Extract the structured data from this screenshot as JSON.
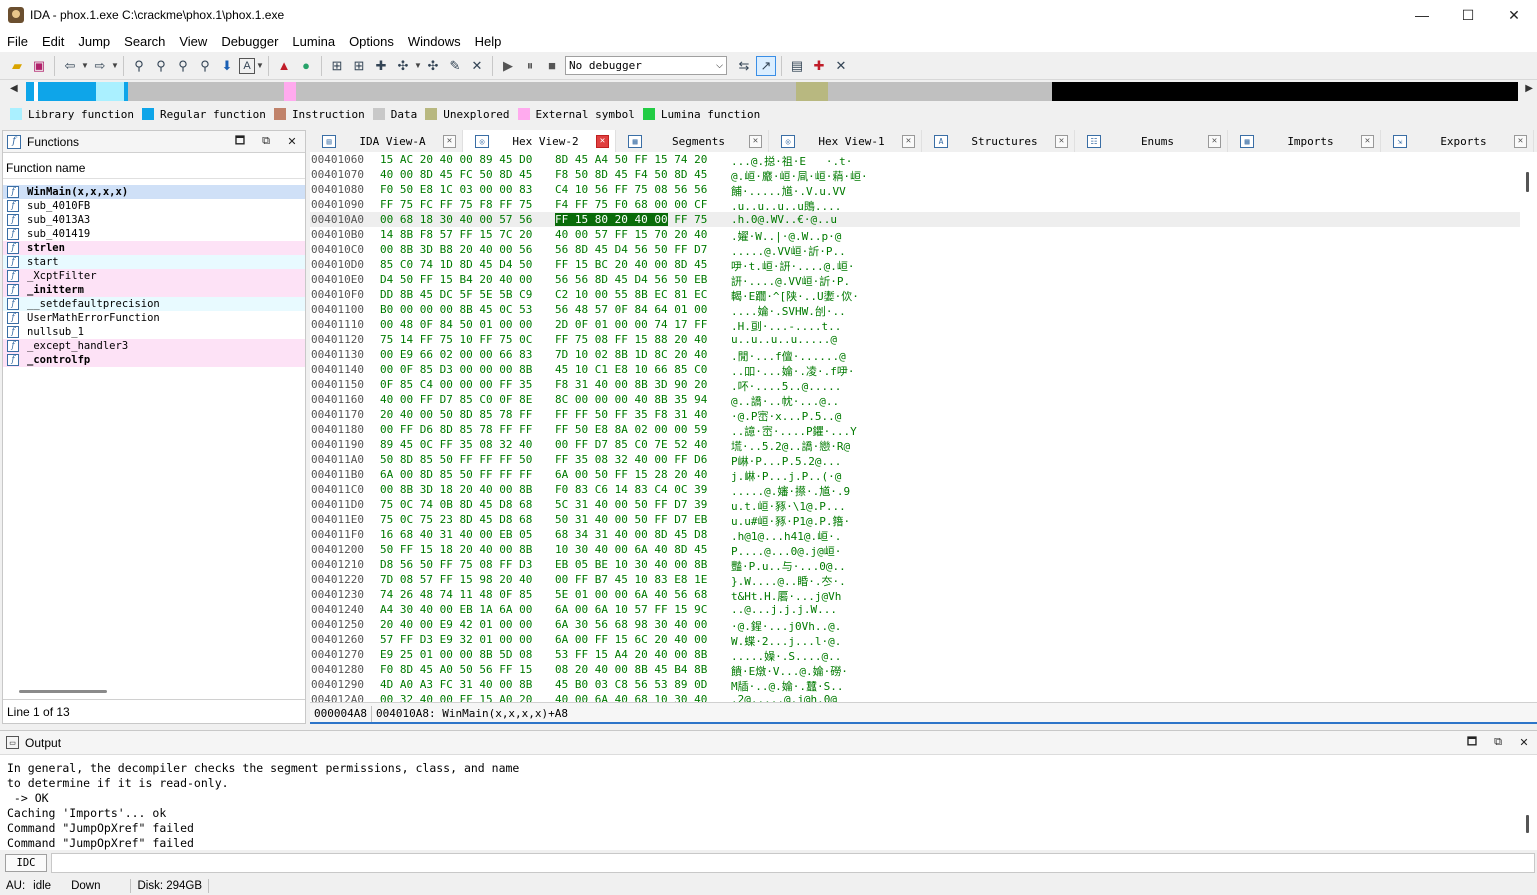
{
  "window": {
    "title": "IDA - phox.1.exe C:\\crackme\\phox.1\\phox.1.exe",
    "controls": [
      "—",
      "☐",
      "✕"
    ]
  },
  "menu": [
    "File",
    "Edit",
    "Jump",
    "Search",
    "View",
    "Debugger",
    "Lumina",
    "Options",
    "Windows",
    "Help"
  ],
  "toolbar": {
    "debugger_select": "No debugger"
  },
  "legend": [
    {
      "label": "Library function",
      "color": "#aaf0ff"
    },
    {
      "label": "Regular function",
      "color": "#0ea5e9"
    },
    {
      "label": "Instruction",
      "color": "#c0826a"
    },
    {
      "label": "Data",
      "color": "#c8c8c8"
    },
    {
      "label": "Unexplored",
      "color": "#b8b880"
    },
    {
      "label": "External symbol",
      "color": "#ffaaee"
    },
    {
      "label": "Lumina function",
      "color": "#22cc44"
    }
  ],
  "functions": {
    "title": "Functions",
    "column": "Function name",
    "items": [
      {
        "name": "WinMain(x,x,x,x)",
        "kind": "sel bold"
      },
      {
        "name": "sub_4010FB",
        "kind": ""
      },
      {
        "name": "sub_4013A3",
        "kind": ""
      },
      {
        "name": "sub_401419",
        "kind": ""
      },
      {
        "name": "strlen",
        "kind": "lib bold"
      },
      {
        "name": "start",
        "kind": "lib2"
      },
      {
        "name": "_XcptFilter",
        "kind": "lib"
      },
      {
        "name": "_initterm",
        "kind": "lib bold"
      },
      {
        "name": "__setdefaultprecision",
        "kind": "lib2"
      },
      {
        "name": "UserMathErrorFunction",
        "kind": ""
      },
      {
        "name": "nullsub_1",
        "kind": ""
      },
      {
        "name": "_except_handler3",
        "kind": "lib"
      },
      {
        "name": "_controlfp",
        "kind": "lib bold"
      }
    ],
    "status": "Line 1 of 13"
  },
  "tabs": [
    {
      "label": "IDA View-A",
      "icon": "▤"
    },
    {
      "label": "Hex View-2",
      "icon": "◎",
      "active": true
    },
    {
      "label": "Segments",
      "icon": "▦"
    },
    {
      "label": "Hex View-1",
      "icon": "◎"
    },
    {
      "label": "Structures",
      "icon": "A"
    },
    {
      "label": "Enums",
      "icon": "☷"
    },
    {
      "label": "Imports",
      "icon": "▦"
    },
    {
      "label": "Exports",
      "icon": "⇲"
    }
  ],
  "hex": {
    "rows": [
      {
        "addr": "00401060",
        "b1": "15 AC 20 40 00 89 45 D0",
        "b2": "8D 45 A4 50 FF 15 74 20",
        "ascii": "...@.搃·祖·E   ·.t·"
      },
      {
        "addr": "00401070",
        "b1": "40 00 8D 45 FC 50 8D 45",
        "b2": "F8 50 8D 45 F4 50 8D 45",
        "ascii": "@.峘·黀·峘·凬·峘·蕱·峘·"
      },
      {
        "addr": "00401080",
        "b1": "F0 50 E8 1C 03 00 00 83",
        "b2": "C4 10 56 FF 75 08 56 56",
        "ascii": "餔·.....馗·.V.u.VV"
      },
      {
        "addr": "00401090",
        "b1": "FF 75 FC FF 75 F8 FF 75",
        "b2": "F4 FF 75 F0 68 00 00 CF",
        "ascii": ".u..u..u..u鵖...."
      },
      {
        "addr": "004010A0",
        "b1": "00 68 18 30 40 00 57 56",
        "b2": "FF 15 80 20 40 00 FF 75",
        "ascii": ".h.0@.WV..€·@..u",
        "cur": true
      },
      {
        "addr": "004010B0",
        "b1": "14 8B F8 57 FF 15 7C 20",
        "b2": "40 00 57 FF 15 70 20 40",
        "ascii": ".嬥·W..|·@.W..p·@"
      },
      {
        "addr": "004010C0",
        "b1": "00 8B 3D B8 20 40 00 56",
        "b2": "56 8D 45 D4 56 50 FF D7",
        "ascii": ".....@.VV峘·訢·P.."
      },
      {
        "addr": "004010D0",
        "b1": "85 C0 74 1D 8D 45 D4 50",
        "b2": "FF 15 BC 20 40 00 8D 45",
        "ascii": "吚·t.峘·訮·....@.峘·"
      },
      {
        "addr": "004010E0",
        "b1": "D4 50 FF 15 B4 20 40 00",
        "b2": "56 56 8D 45 D4 56 50 EB",
        "ascii": "訮·....@.VV峘·訢·P."
      },
      {
        "addr": "004010F0",
        "b1": "DD 8B 45 DC 5F 5E 5B C9",
        "b2": "C2 10 00 55 8B EC 81 EC",
        "ascii": "輵·E躢·^[陕·..U嬱·佽·"
      },
      {
        "addr": "00401100",
        "b1": "B0 00 00 00 8B 45 0C 53",
        "b2": "56 48 57 0F 84 64 01 00",
        "ascii": "....婨·.SVHW.刣·.."
      },
      {
        "addr": "00401110",
        "b1": "00 48 0F 84 50 01 00 00",
        "b2": "2D 0F 01 00 00 74 17 FF",
        "ascii": ".H.刯·...-....t.."
      },
      {
        "addr": "00401120",
        "b1": "75 14 FF 75 10 FF 75 0C",
        "b2": "FF 75 08 FF 15 88 20 40",
        "ascii": "u..u..u..u.....@"
      },
      {
        "addr": "00401130",
        "b1": "00 E9 66 02 00 00 66 83",
        "b2": "7D 10 02 8B 1D 8C 20 40",
        "ascii": ".閒·...f儃·......@"
      },
      {
        "addr": "00401140",
        "b1": "00 0F 85 D3 00 00 00 8B",
        "b2": "45 10 C1 E8 10 66 85 C0",
        "ascii": "..吅·...婨·.凌·.f吚·"
      },
      {
        "addr": "00401150",
        "b1": "0F 85 C4 00 00 00 FF 35",
        "b2": "F8 31 40 00 8B 3D 90 20",
        "ascii": ".吥·....5..@....."
      },
      {
        "addr": "00401160",
        "b1": "40 00 FF D7 85 C0 0F 8E",
        "b2": "8C 00 00 00 40 8B 35 94",
        "ascii": "@..譑·..帎·...@.."
      },
      {
        "addr": "00401170",
        "b1": "20 40 00 50 8D 85 78 FF",
        "b2": "FF FF 50 FF 35 F8 31 40",
        "ascii": "·@.P崈·x...P.5..@"
      },
      {
        "addr": "00401180",
        "b1": "00 FF D6 8D 85 78 FF FF",
        "b2": "FF 50 E8 8A 02 00 00 59",
        "ascii": "..譩·崈·....P鑺·...Y"
      },
      {
        "addr": "00401190",
        "b1": "89 45 0C FF 35 08 32 40",
        "b2": "00 FF D7 85 C0 7E 52 40",
        "ascii": "塃·..5.2@..譑·戀·R@"
      },
      {
        "addr": "004011A0",
        "b1": "50 8D 85 50 FF FF FF 50",
        "b2": "FF 35 08 32 40 00 FF D6",
        "ascii": "P崊·P...P.5.2@..."
      },
      {
        "addr": "004011B0",
        "b1": "6A 00 8D 85 50 FF FF FF",
        "b2": "6A 00 50 FF 15 28 20 40",
        "ascii": "j.崊·P...j.P..(·@"
      },
      {
        "addr": "004011C0",
        "b1": "00 8B 3D 18 20 40 00 8B",
        "b2": "F0 83 C6 14 83 C4 0C 39",
        "ascii": ".....@.嬸·攃·.馗·.9"
      },
      {
        "addr": "004011D0",
        "b1": "75 0C 74 0B 8D 45 D8 68",
        "b2": "5C 31 40 00 50 FF D7 39",
        "ascii": "u.t.峘·豩·\\1@.P..."
      },
      {
        "addr": "004011E0",
        "b1": "75 0C 75 23 8D 45 D8 68",
        "b2": "50 31 40 00 50 FF D7 EB",
        "ascii": "u.u#峘·豩·P1@.P.簎·"
      },
      {
        "addr": "004011F0",
        "b1": "16 68 40 31 40 00 EB 05",
        "b2": "68 34 31 40 00 8D 45 D8",
        "ascii": ".h@1@...h41@.峘·."
      },
      {
        "addr": "00401200",
        "b1": "50 FF 15 18 20 40 00 8B",
        "b2": "10 30 40 00 6A 40 8D 45",
        "ascii": "P....@...0@.j@峘·"
      },
      {
        "addr": "00401210",
        "b1": "D8 56 50 FF 75 08 FF D3",
        "b2": "EB 05 BE 10 30 40 00 8B",
        "ascii": "豔·P.u..与·...0@.."
      },
      {
        "addr": "00401220",
        "b1": "7D 08 57 FF 15 98 20 40",
        "b2": "00 FF B7 45 10 83 E8 1E",
        "ascii": "}.W....@..睧·.冭·."
      },
      {
        "addr": "00401230",
        "b1": "74 26 48 74 11 48 0F 85",
        "b2": "5E 01 00 00 6A 40 56 68",
        "ascii": "t&Ht.H.厬·...j@Vh"
      },
      {
        "addr": "00401240",
        "b1": "A4 30 40 00 EB 1A 6A 00",
        "b2": "6A 00 6A 10 57 FF 15 9C",
        "ascii": "..@...j.j.j.W..."
      },
      {
        "addr": "00401250",
        "b1": "20 40 00 E9 42 01 00 00",
        "b2": "6A 30 56 68 98 30 40 00",
        "ascii": "·@.鍟·...j0Vh..@."
      },
      {
        "addr": "00401260",
        "b1": "57 FF D3 E9 32 01 00 00",
        "b2": "6A 00 FF 15 6C 20 40 00",
        "ascii": "W.蝶·2...j...l·@."
      },
      {
        "addr": "00401270",
        "b1": "E9 25 01 00 00 8B 5D 08",
        "b2": "53 FF 15 A4 20 40 00 8B",
        "ascii": ".....嬠·.S....@.."
      },
      {
        "addr": "00401280",
        "b1": "F0 8D 45 A0 50 56 FF 15",
        "b2": "08 20 40 00 8B 45 B4 8B",
        "ascii": "饋·E燉·V...@.婨·磱·"
      },
      {
        "addr": "00401290",
        "b1": "4D A0 A3 FC 31 40 00 8B",
        "b2": "45 B0 03 C8 56 53 89 0D",
        "ascii": "M牐·..@.婨·.蠺·S.."
      },
      {
        "addr": "004012A0",
        "b1": "00 32 40 00 FF 15 A0 20",
        "b2": "40 00 6A 40 68 10 30 40",
        "ascii": ".2@.....@.j@h.0@"
      }
    ],
    "status_offset": "000004A8",
    "status_location": "004010A8: WinMain(x,x,x,x)+A8"
  },
  "output": {
    "title": "Output",
    "lines": [
      "In general, the decompiler checks the segment permissions, class, and name",
      "to determine if it is read-only.",
      " -> OK",
      "Caching 'Imports'... ok",
      "Command \"JumpOpXref\" failed",
      "Command \"JumpOpXref\" failed"
    ]
  },
  "idc": {
    "label": "IDC",
    "value": ""
  },
  "statusbar": {
    "au": "AU:",
    "state": "idle",
    "direction": "Down",
    "disk": "Disk: 294GB"
  }
}
